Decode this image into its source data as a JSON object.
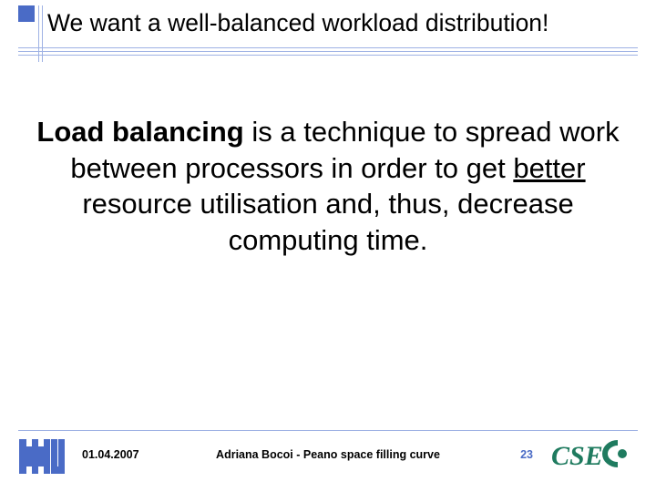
{
  "title": "We want a well-balanced workload distribution!",
  "body": {
    "bold_lead": "Load balancing",
    "mid1": " is a technique to spread work between processors in order to get ",
    "under": "better",
    "mid2": " resource utilisation and, thus, decrease computing time."
  },
  "footer": {
    "date": "01.04.2007",
    "author": "Adriana Bocoi - Peano space filling curve",
    "page": "23"
  },
  "logos": {
    "left": "TUM",
    "right": "CSE"
  },
  "colors": {
    "accent": "#4a6bc6",
    "cse": "#1f7b5f"
  }
}
